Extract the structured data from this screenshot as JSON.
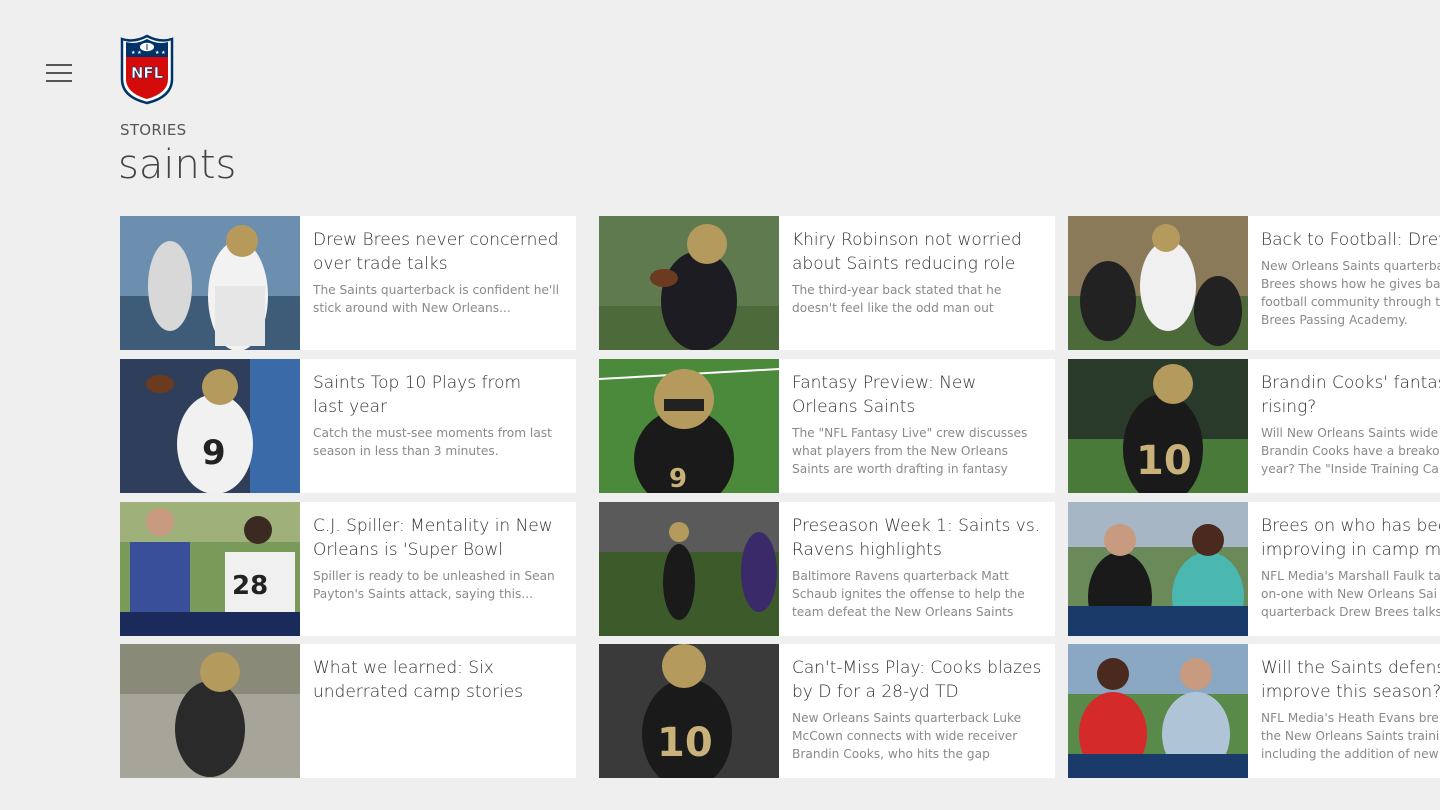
{
  "app": {
    "logo_text": "NFL",
    "section": "STORIES",
    "title": "saints"
  },
  "icons": {
    "menu": "hamburger-menu-icon",
    "logo": "nfl-shield-logo"
  },
  "colors": {
    "background": "#efefef",
    "card": "#ffffff",
    "nfl_blue": "#013369",
    "nfl_red": "#d50a0a"
  },
  "stories": [
    {
      "headline": "Drew Brees never concerned\nover trade talks",
      "summary": "The Saints quarterback is confident he'll\nstick around with New Orleans..."
    },
    {
      "headline": "Saints Top 10 Plays from\nlast year",
      "summary": "Catch the must-see moments from last\nseason in less than 3 minutes."
    },
    {
      "headline": "C.J. Spiller: Mentality in New\nOrleans is 'Super Bowl",
      "summary": "Spiller is ready to be unleashed in Sean\nPayton's Saints attack, saying this..."
    },
    {
      "headline": "What we learned: Six\nunderrated camp stories",
      "summary": ""
    },
    {
      "headline": "Khiry Robinson not worried\nabout Saints reducing role",
      "summary": "The third-year back stated that he\ndoesn't feel like the odd man out"
    },
    {
      "headline": "Fantasy Preview: New\nOrleans Saints",
      "summary": "The \"NFL Fantasy Live\" crew discusses\nwhat players from the New Orleans\nSaints are worth drafting in fantasy"
    },
    {
      "headline": "Preseason Week 1: Saints vs.\nRavens highlights",
      "summary": "Baltimore Ravens quarterback Matt\nSchaub ignites the offense to help the\nteam defeat the New Orleans Saints"
    },
    {
      "headline": "Can't-Miss Play: Cooks blazes\nby D for a 28-yd TD",
      "summary": "New Orleans Saints quarterback Luke\nMcCown connects with wide receiver\nBrandin Cooks, who hits the gap"
    },
    {
      "headline": "Back to Football: Drew",
      "summary": "New Orleans Saints quarterba\nBrees shows how he gives bac\nfootball community through t\nBrees Passing Academy."
    },
    {
      "headline": "Brandin Cooks' fantas\nrising?",
      "summary": "Will New Orleans Saints wide\nBrandin Cooks have a breako\nyear? The \"Inside Training Ca"
    },
    {
      "headline": "Brees on who has bee\nimproving in camp m",
      "summary": "NFL Media's Marshall Faulk ta\non-one with New Orleans Sai\nquarterback Drew Brees talks"
    },
    {
      "headline": "Will the Saints defens\nimprove this season?",
      "summary": "NFL Media's Heath Evans bre\nthe New Orleans Saints traini\nincluding the addition of new"
    }
  ]
}
